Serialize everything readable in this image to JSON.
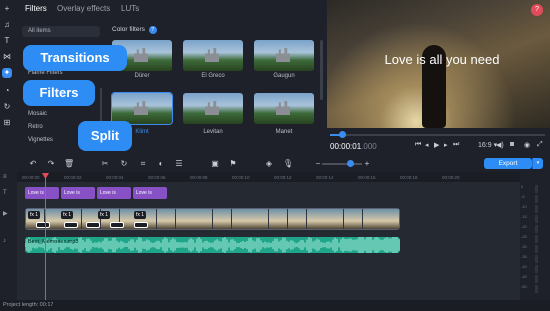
{
  "tabs": {
    "filters": "Filters",
    "overlay": "Overlay effects",
    "luts": "LUTs"
  },
  "categories": {
    "selected": "All items",
    "items": [
      "Flame Filters",
      "Mosaic",
      "Retro",
      "Vignettes"
    ]
  },
  "filter_section": {
    "title": "Color filters",
    "info_icon": "?"
  },
  "filters": [
    {
      "label": "Dürer"
    },
    {
      "label": "El Greco"
    },
    {
      "label": "Gaugun"
    },
    {
      "label": "Klimt",
      "selected": true
    },
    {
      "label": "Levitan"
    },
    {
      "label": "Manet"
    }
  ],
  "preview": {
    "caption": "Love is all you need",
    "help": "?"
  },
  "player": {
    "time_main": "00:00:01",
    "time_frac": ".000",
    "aspect": "16:9 ▾",
    "progress": 0.05
  },
  "toolbar": {
    "export_label": "Export",
    "export_dropdown": "▾"
  },
  "ruler": [
    "00:00:00",
    "00:00:02",
    "00:00:04",
    "00:00:06",
    "00:00:08",
    "00:00:10",
    "00:00:12",
    "00:00:14",
    "00:00:16",
    "00:00:18",
    "00:00:20"
  ],
  "title_clips": [
    {
      "label": "Love is"
    },
    {
      "label": "Love is"
    },
    {
      "label": "Love is"
    },
    {
      "label": "Love is"
    }
  ],
  "fx_badges": [
    "fx 1",
    "fx 1",
    "fx 1",
    "fx 1"
  ],
  "audio": {
    "label": "Best_Memories.mp3"
  },
  "meter_labels": [
    "0",
    "-5",
    "-10",
    "-15",
    "-20",
    "-25",
    "-30",
    "-35",
    "-40",
    "-45",
    "-50"
  ],
  "callouts": {
    "transitions": "Transitions",
    "filters": "Filters",
    "split": "Split"
  },
  "status": {
    "project_length": "Project length: 00:17"
  },
  "colors": {
    "accent": "#2d8df5",
    "title_clip": "#8750c5",
    "audio_clip": "#1fa58a",
    "playhead": "#e24b5a"
  },
  "icons": [
    "plus-icon",
    "music-icon",
    "text-icon",
    "transitions-icon",
    "filters-icon",
    "stickers-icon",
    "undo-icon",
    "redo-icon",
    "trash-icon",
    "cut-icon",
    "rotate-icon",
    "crop-icon",
    "color-icon",
    "list-icon",
    "overlay-icon",
    "flag-icon",
    "marker-icon",
    "mic-icon",
    "zoom-out-icon",
    "zoom-in-icon"
  ]
}
